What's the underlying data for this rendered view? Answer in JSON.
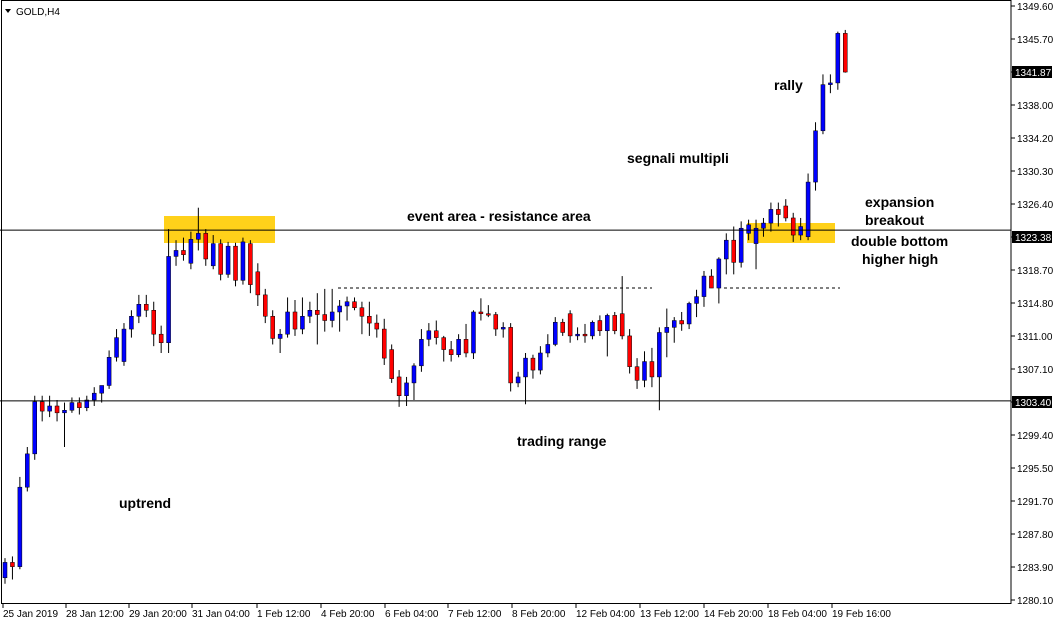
{
  "symbol_label": "GOLD,H4",
  "annotations": {
    "rally": "rally",
    "segnali_multipli": "segnali multipli",
    "event_area": "event area - resistance area",
    "expansion": "expansion",
    "breakout": "breakout",
    "double_bottom": "double bottom",
    "higher_high": "higher high",
    "trading_range": "trading range",
    "uptrend": "uptrend"
  },
  "chart_data": {
    "type": "candlestick",
    "title": "GOLD,H4",
    "y_ticks": [
      "1349.60",
      "1345.70",
      "1341.87",
      "1338.00",
      "1334.20",
      "1330.30",
      "1326.40",
      "1323.38",
      "1318.70",
      "1314.80",
      "1311.00",
      "1307.10",
      "1303.40",
      "1299.40",
      "1295.50",
      "1291.70",
      "1287.80",
      "1283.90",
      "1280.10"
    ],
    "x_ticks": [
      "25 Jan 2019",
      "28 Jan 12:00",
      "29 Jan 20:00",
      "31 Jan 04:00",
      "1 Feb 12:00",
      "4 Feb 20:00",
      "6 Feb 04:00",
      "7 Feb 12:00",
      "8 Feb 20:00",
      "12 Feb 04:00",
      "13 Feb 12:00",
      "14 Feb 20:00",
      "18 Feb 04:00",
      "19 Feb 16:00"
    ],
    "ylim": [
      1280.1,
      1349.6
    ],
    "current_price": "1341.87",
    "resistance_price": "1323.38",
    "support_price": "1303.40",
    "horizontal_lines": [
      1323.38,
      1303.4
    ],
    "dashed_level": 1316.6,
    "colors": {
      "bull": "#0000ff",
      "bear": "#ff0000",
      "highlight": "#ffd11a",
      "line": "#000000",
      "price_tag": "#000000"
    },
    "candles": [
      {
        "o": 1282.7,
        "h": 1285.0,
        "l": 1282.0,
        "c": 1284.5
      },
      {
        "o": 1284.5,
        "h": 1285.2,
        "l": 1282.5,
        "c": 1284.0
      },
      {
        "o": 1284.0,
        "h": 1294.5,
        "l": 1283.7,
        "c": 1293.3
      },
      {
        "o": 1293.3,
        "h": 1298.0,
        "l": 1292.8,
        "c": 1297.2
      },
      {
        "o": 1297.2,
        "h": 1304.0,
        "l": 1296.5,
        "c": 1303.3
      },
      {
        "o": 1303.3,
        "h": 1304.0,
        "l": 1301.0,
        "c": 1302.2
      },
      {
        "o": 1302.2,
        "h": 1304.0,
        "l": 1301.5,
        "c": 1302.8
      },
      {
        "o": 1302.8,
        "h": 1303.5,
        "l": 1301.0,
        "c": 1302.0
      },
      {
        "o": 1302.0,
        "h": 1303.2,
        "l": 1298.0,
        "c": 1302.3
      },
      {
        "o": 1302.3,
        "h": 1303.8,
        "l": 1302.0,
        "c": 1303.2
      },
      {
        "o": 1303.2,
        "h": 1303.8,
        "l": 1301.8,
        "c": 1302.6
      },
      {
        "o": 1302.6,
        "h": 1304.0,
        "l": 1302.2,
        "c": 1303.5
      },
      {
        "o": 1303.5,
        "h": 1305.0,
        "l": 1302.8,
        "c": 1304.3
      },
      {
        "o": 1304.3,
        "h": 1305.0,
        "l": 1303.2,
        "c": 1305.2
      },
      {
        "o": 1305.2,
        "h": 1309.3,
        "l": 1304.8,
        "c": 1308.5
      },
      {
        "o": 1308.5,
        "h": 1311.8,
        "l": 1308.0,
        "c": 1310.8
      },
      {
        "o": 1308.0,
        "h": 1312.5,
        "l": 1307.5,
        "c": 1311.8
      },
      {
        "o": 1311.8,
        "h": 1314.0,
        "l": 1310.8,
        "c": 1313.3
      },
      {
        "o": 1313.3,
        "h": 1315.8,
        "l": 1312.5,
        "c": 1314.7
      },
      {
        "o": 1314.7,
        "h": 1315.8,
        "l": 1313.2,
        "c": 1314.0
      },
      {
        "o": 1314.0,
        "h": 1315.0,
        "l": 1309.8,
        "c": 1311.2
      },
      {
        "o": 1311.2,
        "h": 1312.2,
        "l": 1309.0,
        "c": 1310.2
      },
      {
        "o": 1310.2,
        "h": 1323.5,
        "l": 1309.0,
        "c": 1320.3
      },
      {
        "o": 1320.3,
        "h": 1322.2,
        "l": 1319.2,
        "c": 1321.0
      },
      {
        "o": 1321.0,
        "h": 1322.5,
        "l": 1319.8,
        "c": 1320.5
      },
      {
        "o": 1319.5,
        "h": 1323.2,
        "l": 1318.8,
        "c": 1322.3
      },
      {
        "o": 1322.3,
        "h": 1326.0,
        "l": 1321.0,
        "c": 1323.0
      },
      {
        "o": 1323.0,
        "h": 1323.5,
        "l": 1319.2,
        "c": 1320.0
      },
      {
        "o": 1319.2,
        "h": 1322.8,
        "l": 1318.8,
        "c": 1321.8
      },
      {
        "o": 1321.8,
        "h": 1322.3,
        "l": 1317.5,
        "c": 1318.2
      },
      {
        "o": 1318.2,
        "h": 1322.0,
        "l": 1317.8,
        "c": 1321.5
      },
      {
        "o": 1321.5,
        "h": 1321.9,
        "l": 1316.8,
        "c": 1317.5
      },
      {
        "o": 1317.5,
        "h": 1322.5,
        "l": 1317.0,
        "c": 1322.0
      },
      {
        "o": 1321.8,
        "h": 1322.2,
        "l": 1316.0,
        "c": 1317.0
      },
      {
        "o": 1318.5,
        "h": 1319.5,
        "l": 1314.5,
        "c": 1315.8
      },
      {
        "o": 1315.8,
        "h": 1316.5,
        "l": 1312.5,
        "c": 1313.3
      },
      {
        "o": 1313.3,
        "h": 1314.0,
        "l": 1310.0,
        "c": 1310.7
      },
      {
        "o": 1310.7,
        "h": 1311.8,
        "l": 1309.0,
        "c": 1311.2
      },
      {
        "o": 1311.2,
        "h": 1315.5,
        "l": 1310.8,
        "c": 1313.8
      },
      {
        "o": 1313.8,
        "h": 1315.2,
        "l": 1311.0,
        "c": 1311.8
      },
      {
        "o": 1311.8,
        "h": 1315.5,
        "l": 1311.2,
        "c": 1313.3
      },
      {
        "o": 1313.3,
        "h": 1315.0,
        "l": 1312.5,
        "c": 1314.0
      },
      {
        "o": 1314.0,
        "h": 1316.0,
        "l": 1310.0,
        "c": 1313.5
      },
      {
        "o": 1313.5,
        "h": 1316.5,
        "l": 1311.5,
        "c": 1312.8
      },
      {
        "o": 1312.8,
        "h": 1316.5,
        "l": 1312.0,
        "c": 1313.8
      },
      {
        "o": 1313.8,
        "h": 1315.2,
        "l": 1311.5,
        "c": 1314.5
      },
      {
        "o": 1314.5,
        "h": 1315.6,
        "l": 1312.8,
        "c": 1315.0
      },
      {
        "o": 1315.0,
        "h": 1315.5,
        "l": 1314.0,
        "c": 1314.3
      },
      {
        "o": 1314.3,
        "h": 1315.0,
        "l": 1311.2,
        "c": 1313.3
      },
      {
        "o": 1313.3,
        "h": 1315.0,
        "l": 1311.0,
        "c": 1312.5
      },
      {
        "o": 1312.5,
        "h": 1313.5,
        "l": 1310.8,
        "c": 1311.8
      },
      {
        "o": 1311.8,
        "h": 1313.0,
        "l": 1307.6,
        "c": 1308.4
      },
      {
        "o": 1309.4,
        "h": 1310.0,
        "l": 1305.5,
        "c": 1306.0
      },
      {
        "o": 1306.2,
        "h": 1307.0,
        "l": 1302.7,
        "c": 1304.0
      },
      {
        "o": 1304.0,
        "h": 1306.2,
        "l": 1302.8,
        "c": 1305.5
      },
      {
        "o": 1305.5,
        "h": 1307.8,
        "l": 1303.5,
        "c": 1307.5
      },
      {
        "o": 1307.5,
        "h": 1311.8,
        "l": 1306.8,
        "c": 1310.6
      },
      {
        "o": 1310.6,
        "h": 1312.5,
        "l": 1309.8,
        "c": 1311.6
      },
      {
        "o": 1311.6,
        "h": 1312.8,
        "l": 1310.0,
        "c": 1310.8
      },
      {
        "o": 1310.8,
        "h": 1311.0,
        "l": 1308.0,
        "c": 1309.4
      },
      {
        "o": 1309.4,
        "h": 1310.4,
        "l": 1308.0,
        "c": 1308.8
      },
      {
        "o": 1308.8,
        "h": 1311.2,
        "l": 1308.5,
        "c": 1310.6
      },
      {
        "o": 1310.6,
        "h": 1312.4,
        "l": 1308.5,
        "c": 1309.0
      },
      {
        "o": 1309.0,
        "h": 1314.0,
        "l": 1308.3,
        "c": 1313.8
      },
      {
        "o": 1313.8,
        "h": 1315.4,
        "l": 1312.8,
        "c": 1313.6
      },
      {
        "o": 1313.6,
        "h": 1314.6,
        "l": 1313.2,
        "c": 1313.5
      },
      {
        "o": 1313.5,
        "h": 1313.8,
        "l": 1311.0,
        "c": 1311.8
      },
      {
        "o": 1311.8,
        "h": 1312.6,
        "l": 1310.8,
        "c": 1312.0
      },
      {
        "o": 1312.0,
        "h": 1312.5,
        "l": 1304.5,
        "c": 1305.5
      },
      {
        "o": 1305.5,
        "h": 1306.8,
        "l": 1305.0,
        "c": 1306.2
      },
      {
        "o": 1306.2,
        "h": 1309.0,
        "l": 1303.0,
        "c": 1308.4
      },
      {
        "o": 1308.4,
        "h": 1308.8,
        "l": 1306.0,
        "c": 1307.0
      },
      {
        "o": 1307.0,
        "h": 1309.8,
        "l": 1306.5,
        "c": 1309.0
      },
      {
        "o": 1309.0,
        "h": 1311.2,
        "l": 1308.5,
        "c": 1310.0
      },
      {
        "o": 1310.0,
        "h": 1313.2,
        "l": 1309.8,
        "c": 1312.6
      },
      {
        "o": 1312.6,
        "h": 1313.0,
        "l": 1311.0,
        "c": 1311.4
      },
      {
        "o": 1313.6,
        "h": 1314.0,
        "l": 1310.2,
        "c": 1311.0
      },
      {
        "o": 1311.0,
        "h": 1312.0,
        "l": 1310.5,
        "c": 1311.2
      },
      {
        "o": 1311.2,
        "h": 1312.4,
        "l": 1310.2,
        "c": 1311.0
      },
      {
        "o": 1311.0,
        "h": 1312.8,
        "l": 1310.6,
        "c": 1312.6
      },
      {
        "o": 1312.8,
        "h": 1313.4,
        "l": 1311.0,
        "c": 1311.6
      },
      {
        "o": 1311.6,
        "h": 1313.6,
        "l": 1308.6,
        "c": 1313.4
      },
      {
        "o": 1313.4,
        "h": 1313.8,
        "l": 1311.2,
        "c": 1311.6
      },
      {
        "o": 1313.6,
        "h": 1318.0,
        "l": 1310.6,
        "c": 1311.0
      },
      {
        "o": 1311.0,
        "h": 1311.8,
        "l": 1306.6,
        "c": 1307.4
      },
      {
        "o": 1307.4,
        "h": 1308.4,
        "l": 1304.8,
        "c": 1305.8
      },
      {
        "o": 1305.8,
        "h": 1309.2,
        "l": 1305.0,
        "c": 1308.0
      },
      {
        "o": 1308.0,
        "h": 1309.6,
        "l": 1305.0,
        "c": 1306.2
      },
      {
        "o": 1306.2,
        "h": 1312.0,
        "l": 1302.3,
        "c": 1311.4
      },
      {
        "o": 1311.4,
        "h": 1314.2,
        "l": 1308.5,
        "c": 1312.0
      },
      {
        "o": 1312.0,
        "h": 1313.2,
        "l": 1310.2,
        "c": 1312.8
      },
      {
        "o": 1312.8,
        "h": 1313.8,
        "l": 1311.6,
        "c": 1312.4
      },
      {
        "o": 1312.4,
        "h": 1315.0,
        "l": 1311.8,
        "c": 1314.8
      },
      {
        "o": 1314.8,
        "h": 1316.4,
        "l": 1313.2,
        "c": 1315.6
      },
      {
        "o": 1315.6,
        "h": 1318.6,
        "l": 1314.4,
        "c": 1318.0
      },
      {
        "o": 1318.0,
        "h": 1318.8,
        "l": 1316.6,
        "c": 1316.6
      },
      {
        "o": 1316.6,
        "h": 1320.2,
        "l": 1314.8,
        "c": 1320.0
      },
      {
        "o": 1320.0,
        "h": 1323.0,
        "l": 1318.2,
        "c": 1322.2
      },
      {
        "o": 1322.2,
        "h": 1323.8,
        "l": 1318.2,
        "c": 1319.6
      },
      {
        "o": 1319.6,
        "h": 1324.4,
        "l": 1319.0,
        "c": 1323.6
      },
      {
        "o": 1323.0,
        "h": 1324.6,
        "l": 1322.2,
        "c": 1324.0
      },
      {
        "o": 1321.8,
        "h": 1324.6,
        "l": 1318.8,
        "c": 1323.6
      },
      {
        "o": 1323.6,
        "h": 1324.8,
        "l": 1322.6,
        "c": 1324.2
      },
      {
        "o": 1324.2,
        "h": 1326.6,
        "l": 1323.2,
        "c": 1325.8
      },
      {
        "o": 1325.8,
        "h": 1326.6,
        "l": 1323.8,
        "c": 1325.2
      },
      {
        "o": 1326.2,
        "h": 1327.0,
        "l": 1324.4,
        "c": 1324.8
      },
      {
        "o": 1324.8,
        "h": 1325.4,
        "l": 1322.0,
        "c": 1322.8
      },
      {
        "o": 1322.8,
        "h": 1324.8,
        "l": 1322.2,
        "c": 1323.8
      },
      {
        "o": 1322.6,
        "h": 1330.0,
        "l": 1322.2,
        "c": 1329.0
      },
      {
        "o": 1329.0,
        "h": 1336.0,
        "l": 1328.0,
        "c": 1335.0
      },
      {
        "o": 1335.0,
        "h": 1341.6,
        "l": 1334.6,
        "c": 1340.4
      },
      {
        "o": 1340.4,
        "h": 1341.6,
        "l": 1339.4,
        "c": 1340.6
      },
      {
        "o": 1340.6,
        "h": 1346.6,
        "l": 1339.8,
        "c": 1346.4
      },
      {
        "o": 1346.4,
        "h": 1346.8,
        "l": 1341.8,
        "c": 1341.87
      }
    ]
  }
}
